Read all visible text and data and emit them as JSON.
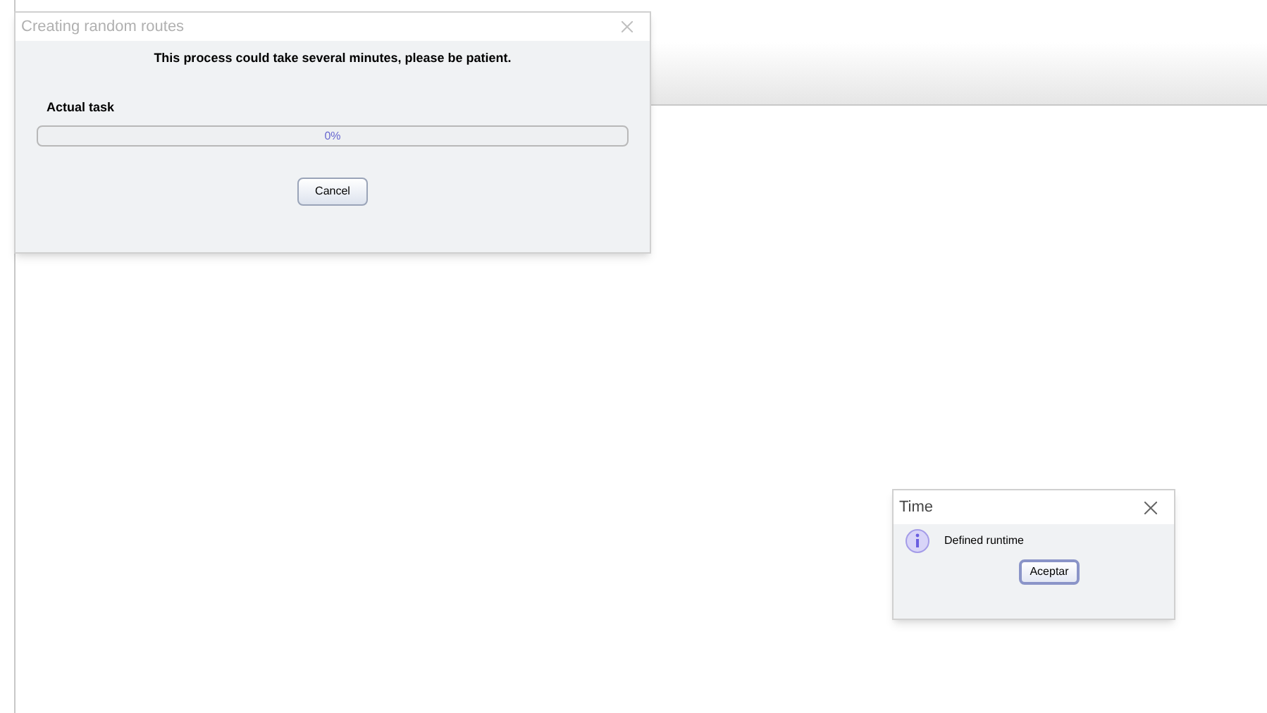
{
  "progress_dialog": {
    "title": "Creating random routes",
    "message": "This process could take several minutes, please be patient.",
    "task_label": "Actual task",
    "progress": {
      "level": 0,
      "reading": "0%"
    },
    "buttons": [
      "Cancel"
    ]
  },
  "info_dialog": {
    "title": "Time",
    "message": "Defined runtime",
    "buttons": [
      "Aceptar"
    ]
  }
}
